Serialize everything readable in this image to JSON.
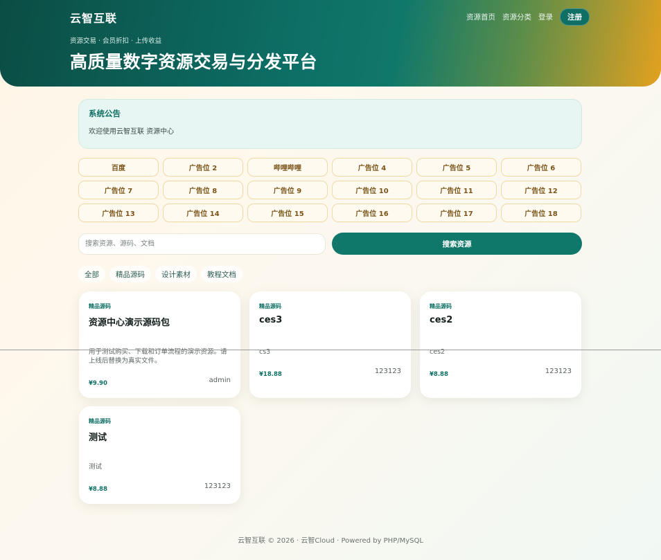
{
  "header": {
    "brand": "云智互联",
    "nav": [
      "资源首页",
      "资源分类",
      "登录"
    ],
    "cta": "注册",
    "subtitle": "资源交易 · 会员折扣 · 上传收益",
    "title": "高质量数字资源交易与分发平台"
  },
  "notice": {
    "title": "系统公告",
    "text": "欢迎使用云智互联 资源中心"
  },
  "ads": [
    "百度",
    "广告位 2",
    "哔哩哔哩",
    "广告位 4",
    "广告位 5",
    "广告位 6",
    "广告位 7",
    "广告位 8",
    "广告位 9",
    "广告位 10",
    "广告位 11",
    "广告位 12",
    "广告位 13",
    "广告位 14",
    "广告位 15",
    "广告位 16",
    "广告位 17",
    "广告位 18"
  ],
  "search": {
    "placeholder": "搜索资源、源码、文档",
    "value": "",
    "button": "搜索资源"
  },
  "tabs": [
    "全部",
    "精品源码",
    "设计素材",
    "教程文档"
  ],
  "cards": [
    {
      "category": "精品源码",
      "title": "资源中心演示源码包",
      "desc": "用于测试购买、下载和订单流程的演示资源。请上线后替换为真实文件。",
      "price": "¥9.90",
      "author": "admin"
    },
    {
      "category": "精品源码",
      "title": "ces3",
      "desc": "cs3",
      "price": "¥18.88",
      "author": "123123"
    },
    {
      "category": "精品源码",
      "title": "ces2",
      "desc": "ces2",
      "price": "¥8.88",
      "author": "123123"
    },
    {
      "category": "精品源码",
      "title": "测试",
      "desc": "测试",
      "price": "¥8.88",
      "author": "123123"
    }
  ],
  "footer": "云智互联 © 2026 · 云智Cloud · Powered by PHP/MySQL",
  "colors": {
    "accent": "#10786a",
    "ad_border": "#f1d9a4",
    "ad_text": "#7a5418",
    "notice_bg": "#e8f6f3"
  }
}
